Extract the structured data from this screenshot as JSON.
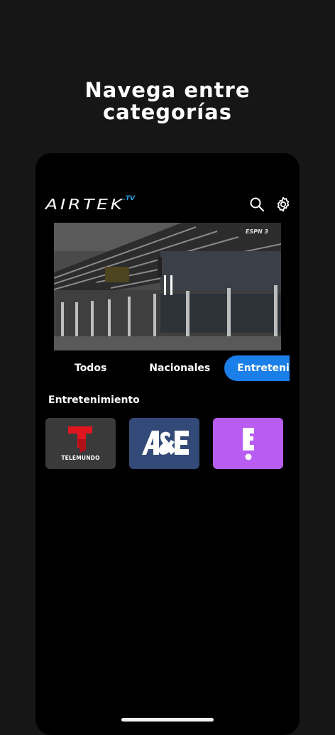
{
  "promo": {
    "headline_line1": "Navega entre",
    "headline_line2": "categorías"
  },
  "app": {
    "logo_text": "AIRTEK",
    "logo_suffix": ".TV",
    "search_icon": "search-icon",
    "settings_icon": "gear-icon"
  },
  "player": {
    "watermark": "ESPN 3",
    "state": "paused"
  },
  "tabs": [
    {
      "label": "Todos"
    },
    {
      "label": "Nacionales"
    },
    {
      "label": "Entretenimiento"
    }
  ],
  "active_tab": 2,
  "section": {
    "title": "Entretenimiento"
  },
  "channels": [
    {
      "name": "TELEMUNDO",
      "color": "#3a3a3a"
    },
    {
      "name": "A&E",
      "color": "#334a78"
    },
    {
      "name": "E!",
      "color": "#b85cf2"
    }
  ],
  "colors": {
    "accent": "#1a7fe8",
    "logo_tv": "#27a3e8",
    "telemundo_red": "#e0161e"
  }
}
